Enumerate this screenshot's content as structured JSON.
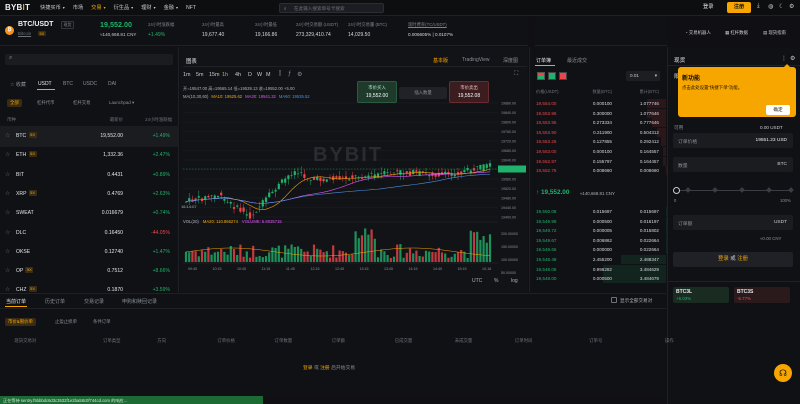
{
  "nav": {
    "logo_a": "BYB",
    "logo_b": "I",
    "logo_c": "T",
    "menu": [
      "快捷买币",
      "市场",
      "交易",
      "衍生品",
      "理财",
      "金融",
      "NFT"
    ],
    "search_placeholder": "在此输入搜索单号卡搜索",
    "login": "登录",
    "register": "注册"
  },
  "ticker": {
    "pair": "BTC/USDT",
    "sub": "Bitcoin",
    "tag": "现货",
    "lev": "5X",
    "price": "19,552.00",
    "cny": "≈140,668.81 CNY",
    "stats": [
      {
        "l": "24小时涨跌幅",
        "v": "+1.49%"
      },
      {
        "l": "24小时最高",
        "v": "19,677.40"
      },
      {
        "l": "24小时最低",
        "v": "19,166.86"
      },
      {
        "l": "24小时交易额 (USDT)",
        "v": "273,329,410.74"
      },
      {
        "l": "24小时交易量 (BTC)",
        "v": "14,029.50"
      }
    ],
    "fee_l": "现时费率(TC/USDT)",
    "fee_v": "0.006605% | 0.0107%"
  },
  "right_top": {
    "a": "交易机器人",
    "b": "杠杆数据",
    "c": "现货指南"
  },
  "left": {
    "tabs": [
      "收藏",
      "USDT",
      "BTC",
      "USDC",
      "DAI"
    ],
    "sub_tabs": [
      "全部",
      "杠杆代币",
      "杠杆交易",
      "Launchpad"
    ],
    "cols": [
      "币种",
      "最新价",
      "24小时涨跌幅"
    ],
    "rows": [
      {
        "sym": "BTC",
        "lev": "5X",
        "price": "19,552.00",
        "chg": "+1.49%",
        "up": true
      },
      {
        "sym": "ETH",
        "lev": "5X",
        "price": "1,332.36",
        "chg": "+2.47%",
        "up": true
      },
      {
        "sym": "BIT",
        "lev": "",
        "price": "0.4431",
        "chg": "+0.89%",
        "up": true
      },
      {
        "sym": "XRP",
        "lev": "5X",
        "price": "0.4769",
        "chg": "+2.63%",
        "up": true
      },
      {
        "sym": "SWEAT",
        "lev": "",
        "price": "0.016679",
        "chg": "+0.74%",
        "up": true
      },
      {
        "sym": "DLC",
        "lev": "",
        "price": "0.16450",
        "chg": "-44.05%",
        "up": false
      },
      {
        "sym": "OKSE",
        "lev": "",
        "price": "0.12740",
        "chg": "+1.47%",
        "up": true
      },
      {
        "sym": "OP",
        "lev": "5X",
        "price": "0.7512",
        "chg": "+8.66%",
        "up": true
      },
      {
        "sym": "CHZ",
        "lev": "5X",
        "price": "0.1870",
        "chg": "+3.59%",
        "up": true
      }
    ]
  },
  "chart": {
    "title": "图表",
    "tabs": [
      "基本版",
      "TradingView",
      "深度图"
    ],
    "intervals": [
      "1m",
      "5m",
      "15m",
      "1h",
      "4h",
      "D",
      "W",
      "M"
    ],
    "ohlc": "开=19547.00 高=19565.14 低=19539.13 收=19552.00 +5.00",
    "ma": [
      {
        "l": "MA(10,30,60)",
        "v": ""
      },
      {
        "l": "MA10:",
        "v": "19525.62"
      },
      {
        "l": "MA30:",
        "v": "19541.32"
      },
      {
        "l": "MA60:",
        "v": "19535.52"
      }
    ],
    "buy_l": "市价买入",
    "buy_v": "19,552.00",
    "sell_l": "市价卖出",
    "sell_v": "19,552.08",
    "insert": "插入数量",
    "watermark": "BYBIT",
    "vol_l": "VOL(20)",
    "vol_ma": "MA20: 110.866274",
    "vol_v": "VOLUME: 5.8025715",
    "yaxis": [
      "19880.00",
      "19840.00",
      "19800.00",
      "19760.00",
      "19720.00",
      "19680.00",
      "19640.00",
      "19600.00",
      "19560.00",
      "19520.00",
      "19480.00",
      "19440.00",
      "19400.00"
    ],
    "vaxis": [
      "200.00000",
      "150.00000",
      "100.00000",
      "50.00000"
    ],
    "xaxis": [
      "09:45",
      "10:15",
      "10:45",
      "11:15",
      "11:45",
      "12:15",
      "12:45",
      "13:15",
      "13:45",
      "14:15",
      "14:45",
      "15:15",
      "10-16"
    ],
    "foot": [
      "UTC",
      "%",
      "log"
    ],
    "timestamp": "16:14:07"
  },
  "ob": {
    "tabs": [
      "订单簿",
      "最近成交"
    ],
    "prec": "0.01",
    "cols": [
      "价格(USDT)",
      "数量(BTC)",
      "累计(BTC)"
    ],
    "asks": [
      [
        "19,554.00",
        "0.000100",
        "1.077746"
      ],
      [
        "19,553.96",
        "0.300000",
        "1.077646"
      ],
      [
        "19,553.95",
        "0.273334",
        "0.777646"
      ],
      [
        "19,553.90",
        "0.211900",
        "0.504312"
      ],
      [
        "19,553.26",
        "0.127855",
        "0.292412"
      ],
      [
        "19,553.00",
        "0.000100",
        "0.164557"
      ],
      [
        "19,552.97",
        "0.155797",
        "0.164457"
      ],
      [
        "19,552.75",
        "0.008660",
        "0.008660"
      ]
    ],
    "mid": "19,552.00",
    "mid_cny": "≈140,668.81 CNY",
    "bids": [
      [
        "19,550.08",
        "0.015697",
        "0.015697"
      ],
      [
        "19,549.99",
        "0.000500",
        "0.016197"
      ],
      [
        "19,549.72",
        "0.000005",
        "0.015802"
      ],
      [
        "19,549.67",
        "0.006862",
        "0.022664"
      ],
      [
        "19,549.66",
        "0.000000",
        "0.022664"
      ],
      [
        "19,548.48",
        "2.455200",
        "2.488347"
      ],
      [
        "19,548.05",
        "0.996282",
        "3.484629"
      ],
      [
        "19,548.00",
        "0.000500",
        "3.484679"
      ]
    ]
  },
  "trade": {
    "title": "现货",
    "tabs": [
      "限价",
      "市价",
      "条件"
    ],
    "tip_title": "新功能",
    "tip_body": "点击此处设置\"快捷下单\"功能。",
    "tip_btn": "确定",
    "avail": "可用",
    "avail_v": "0.00 USDT",
    "price_l": "订单价格",
    "price_v": "19551.23 USD",
    "qty_l": "数量",
    "qty_unit": "BTC",
    "pct": [
      "0",
      "100%"
    ],
    "val_l": "订单额",
    "val_unit": "USDT",
    "val_sub": "≈0.00 CNY",
    "login_a": "登录",
    "login_or": "或",
    "login_b": "注册",
    "etf": [
      {
        "n": "BTC3L",
        "v": "+6.03%",
        "up": true
      },
      {
        "n": "BTC3S",
        "v": "-5.77%",
        "up": false
      }
    ]
  },
  "bottom": {
    "tabs": [
      "当前订单",
      "历史订单",
      "交易记录",
      "申购和赎回记录"
    ],
    "show_all": "显示全部交易对",
    "sub": [
      "市价&限价单",
      "止盈止损单",
      "条件订单"
    ],
    "cols": [
      "现货交易对",
      "订单类型",
      "方向",
      "订单价格",
      "订单数量",
      "订单额",
      "已成交量",
      "未成交量",
      "订单时间",
      "订单号",
      "操作"
    ],
    "empty_a": "登录",
    "empty_or": "或",
    "empty_b": "注册",
    "empty_c": "后开始交易"
  },
  "status": "正在等待 sentry.f5bbbdc6d3c3532f1e2ba58c0f744cd.com 的响应..."
}
